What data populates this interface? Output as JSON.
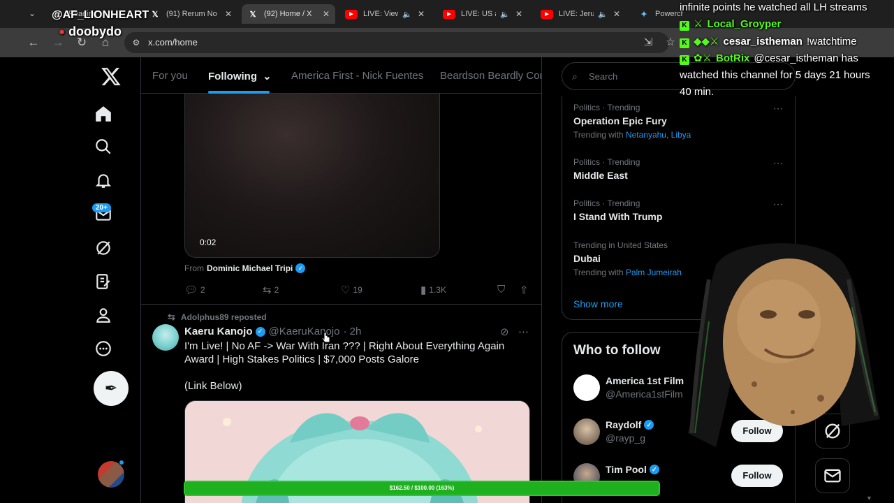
{
  "browser": {
    "tabs": [
      {
        "title": "Reading",
        "icon": "x-logo-icon",
        "active": false
      },
      {
        "title": "(91) Rerum No",
        "icon": "x-logo-icon",
        "active": false
      },
      {
        "title": "(92) Home / X",
        "icon": "x-logo-icon",
        "active": true
      },
      {
        "title": "LIVE: View",
        "icon": "youtube-icon",
        "active": false
      },
      {
        "title": "LIVE: US a",
        "icon": "youtube-icon",
        "active": false
      },
      {
        "title": "LIVE: Jerus",
        "icon": "youtube-icon",
        "active": false
      },
      {
        "title": "Powerchat",
        "icon": "powerchat-icon",
        "active": false
      }
    ],
    "url": "x.com/home"
  },
  "feed_tabs": [
    {
      "label": "For you"
    },
    {
      "label": "Following"
    },
    {
      "label": "America First - Nick Fuentes"
    },
    {
      "label": "Beardson Beardly Com"
    }
  ],
  "nav": {
    "messages_badge": "20+"
  },
  "video_post": {
    "duration": "0:02",
    "from_label": "From",
    "from_name": "Dominic Michael Tripi",
    "replies": "2",
    "reposts": "2",
    "likes": "19",
    "views": "1.3K"
  },
  "repost_post": {
    "reposted_by": "Adolphus89 reposted",
    "author_name": "Kaeru Kanojo",
    "author_handle": "@KaeruKanojo",
    "time": "· 2h",
    "text": "I'm Live! | No AF -> War With Iran ??? | Right About Everything Again Award | High Stakes Politics | $7,000 Posts Galore",
    "link_text": "(Link Below)"
  },
  "sidebar": {
    "search_placeholder": "Search",
    "trends": [
      {
        "category": "Politics · Trending",
        "title": "Operation Epic Fury",
        "with_label": "Trending with",
        "with_links": "Netanyahu, Libya"
      },
      {
        "category": "Politics · Trending",
        "title": "Middle East",
        "with_label": "",
        "with_links": ""
      },
      {
        "category": "Politics · Trending",
        "title": "I Stand With Trump",
        "with_label": "",
        "with_links": ""
      },
      {
        "category": "Trending in United States",
        "title": "Dubai",
        "with_label": "Trending with",
        "with_links": "Palm Jumeirah"
      }
    ],
    "show_more": "Show more",
    "who_to_follow": {
      "title": "Who to follow",
      "accounts": [
        {
          "name": "America 1st Film",
          "handle": "@America1stFilm",
          "follow": "Follow"
        },
        {
          "name": "Raydolf",
          "handle": "@rayp_g",
          "follow": "Follow"
        },
        {
          "name": "Tim Pool",
          "handle": "",
          "follow": "Follow"
        }
      ]
    }
  },
  "stream_overlay": {
    "user_line1": "@AF_LIONHEART",
    "user_line2": "doobydo",
    "chat": [
      {
        "user": "",
        "text": "infinite points he watched all LH streams"
      },
      {
        "user": "Local_Groyper",
        "text": ""
      },
      {
        "user": "cesar_istheman",
        "text": "!watchtime"
      },
      {
        "user": "BotRix",
        "text": "@cesar_istheman has"
      },
      {
        "user": "",
        "text": "watched this channel for 5 days 21 hours"
      },
      {
        "user": "",
        "text": "40 min."
      }
    ],
    "goal_text": "$162.50 / $100.00 (163%)",
    "goal_fraction": 1.0
  },
  "colors": {
    "accent": "#1d9bf0",
    "kick_green": "#53fc18",
    "goal_green": "#1fb01f"
  }
}
